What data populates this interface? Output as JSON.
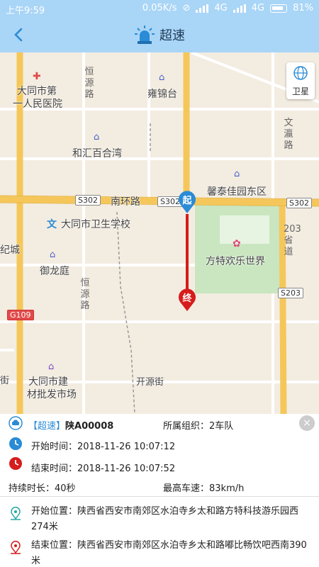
{
  "status": {
    "time": "上午9:59",
    "speed": "0.05K/s",
    "network1": "4G",
    "network2": "4G",
    "battery": "81%"
  },
  "header": {
    "title": "超速",
    "back_icon": "chevron-left-icon",
    "title_icon": "siren-icon"
  },
  "map": {
    "satellite_label": "卫星",
    "labels": {
      "hospital": "大同市第",
      "hospital2": "一人民医院",
      "hengyuan": "恒源路",
      "yongjintai": "雍锦台",
      "wenying": "文瀛路",
      "hehui": "和汇百合湾",
      "xinhtai": "馨泰佳园东区",
      "nanhuan": "南环路",
      "school": "大同市卫生学校",
      "fangte": "方特欢乐世界",
      "jicheng": "纪城",
      "yulong": "御龙庭",
      "sheng203": "203省道",
      "hengyuan2": "恒源路",
      "jiancai": "大同市建",
      "jiancai2": "材批发市场",
      "kaiyuan": "开源街",
      "jie": "街"
    },
    "road_tags": {
      "s302a": "S302",
      "s302b": "S302",
      "s302c": "S302",
      "s203": "S203",
      "g109": "G109"
    },
    "start_marker": "起",
    "end_marker": "终"
  },
  "info": {
    "tag": "【超速】",
    "plate": "陕A00008",
    "org_label": "所属组织：",
    "org_value": "2车队",
    "start_time_label": "开始时间：",
    "start_time": "2018-11-26 10:07:12",
    "end_time_label": "结束时间：",
    "end_time": "2018-11-26 10:07:52",
    "duration_label": "持续时长：",
    "duration": "40秒",
    "max_speed_label": "最高车速：",
    "max_speed": "83km/h",
    "start_loc_label": "开始位置：",
    "start_loc_line1": "陕西省西安市南郊区水泊寺乡太和路方特科技游乐园西",
    "start_loc_line2": "274米",
    "end_loc_label": "结束位置：",
    "end_loc_line1": "陕西省西安市南郊区水泊寺乡太和路嘟比畅饮吧西南390",
    "end_loc_line2": "米",
    "close": "×"
  },
  "colors": {
    "header_bg": "#a9d5f7",
    "accent_blue": "#2a8bd6",
    "route_red": "#d61c1c",
    "map_bg": "#f3ece0",
    "road_yellow": "#f5c75a"
  }
}
